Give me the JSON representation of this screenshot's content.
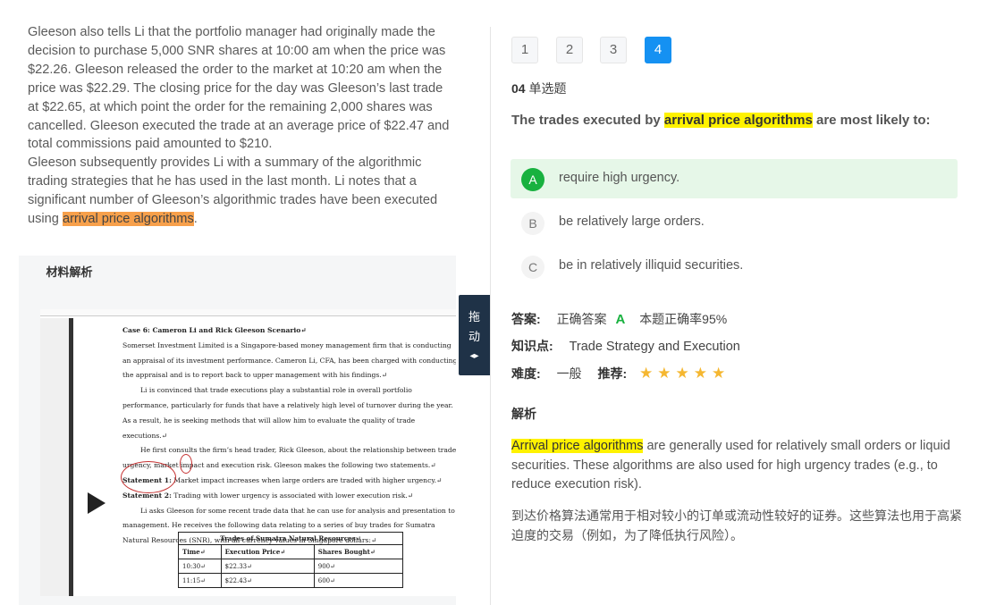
{
  "passage": {
    "para1_before": "Gleeson also tells Li that the portfolio manager had originally made the decision to purchase 5,000 SNR shares at 10:00 am when the price was $22.26. Gleeson released the order to the market at 10:20 am when the price was $22.29. The closing price for the day was Gleeson’s last trade at $22.65, at which point the order for the remaining 2,000 shares was cancelled. Gleeson executed the trade at an average price of $22.47 and total commissions paid amounted to $210.",
    "para2_before": "Gleeson subsequently provides Li with a summary of the algorithmic trading strategies that he has used in the last month. Li notes that a significant number of Gleeson’s algorithmic trades have been executed using ",
    "para2_highlight": "arrival price algorithms",
    "para2_after": "."
  },
  "material_tab": "材料解析",
  "drag_handle": {
    "line1": "拖",
    "line2": "动",
    "line3": "◂▸"
  },
  "doc": {
    "title": "Case 6: Cameron Li and Rick Gleeson Scenario↵",
    "p1": "Somerset Investment Limited is a Singapore-based money management firm that is conducting an appraisal of its investment performance. Cameron Li, CFA, has been charged with conducting the appraisal and is to report back to upper management with his findings.↵",
    "p2": "Li is convinced that trade executions play a substantial role in overall portfolio performance, particularly for funds that have a relatively high level of turnover during the year. As a result, he is seeking methods that will allow him to evaluate the quality of trade executions.↵",
    "p3": "He first consults the firm’s head trader, Rick Gleeson, about the relationship between trade urgency, market impact and execution risk. Gleeson makes the following two statements.↵",
    "s1_label": "Statement 1:",
    "s1_text": " Market impact increases when large orders are traded with higher urgency.↵",
    "s2_label": "Statement 2:",
    "s2_text": " Trading with lower urgency is associated with lower execution risk.↵",
    "p4": "Li asks Gleeson for some recent trade data that he can use for analysis and presentation to management. He receives the following data relating to a series of buy trades for Sumatra Natural Resources (SNR), with all currency values in Singapore dollars:↵",
    "table_caption": "Trades of Sumatra Natural Resources↵",
    "table_headers": [
      "Time↵",
      "Execution Price↵",
      "Shares Bought↵"
    ],
    "table_rows": [
      [
        "10:30↵",
        "$22.33↵",
        "900↵"
      ],
      [
        "11:15↵",
        "$22.43↵",
        "600↵"
      ]
    ]
  },
  "question_nav": [
    "1",
    "2",
    "3",
    "4"
  ],
  "question": {
    "number": "04",
    "type": "单选题",
    "text_before": "The trades executed by ",
    "text_highlight": "arrival price algorithms",
    "text_after": " are most likely to:"
  },
  "options": [
    {
      "letter": "A",
      "text": "require high urgency."
    },
    {
      "letter": "B",
      "text": "be relatively large orders."
    },
    {
      "letter": "C",
      "text": "be in relatively illiquid securities."
    }
  ],
  "answer": {
    "label": "答案:",
    "correct_label": "正确答案",
    "correct_letter": "A",
    "rate": "本题正确率95%"
  },
  "knowledge": {
    "label": "知识点:",
    "value": "Trade Strategy and Execution"
  },
  "difficulty": {
    "label": "难度:",
    "value": "一般",
    "recommend_label": "推荐:",
    "stars": 5
  },
  "analysis": {
    "title": "解析",
    "en_highlight": "Arrival price algorithms",
    "en_rest": " are generally used for relatively small orders or liquid securities. These algorithms are also used for high urgency trades (e.g., to reduce execution risk).",
    "zh": "到达价格算法通常用于相对较小的订单或流动性较好的证券。这些算法也用于高紧迫度的交易（例如，为了降低执行风险）。"
  },
  "colors": {
    "accent_blue": "#1591f2",
    "correct_green": "#18b13f",
    "highlight_yellow": "#fff200",
    "highlight_orange": "#f7a04b",
    "star_gold": "#f5b731"
  }
}
